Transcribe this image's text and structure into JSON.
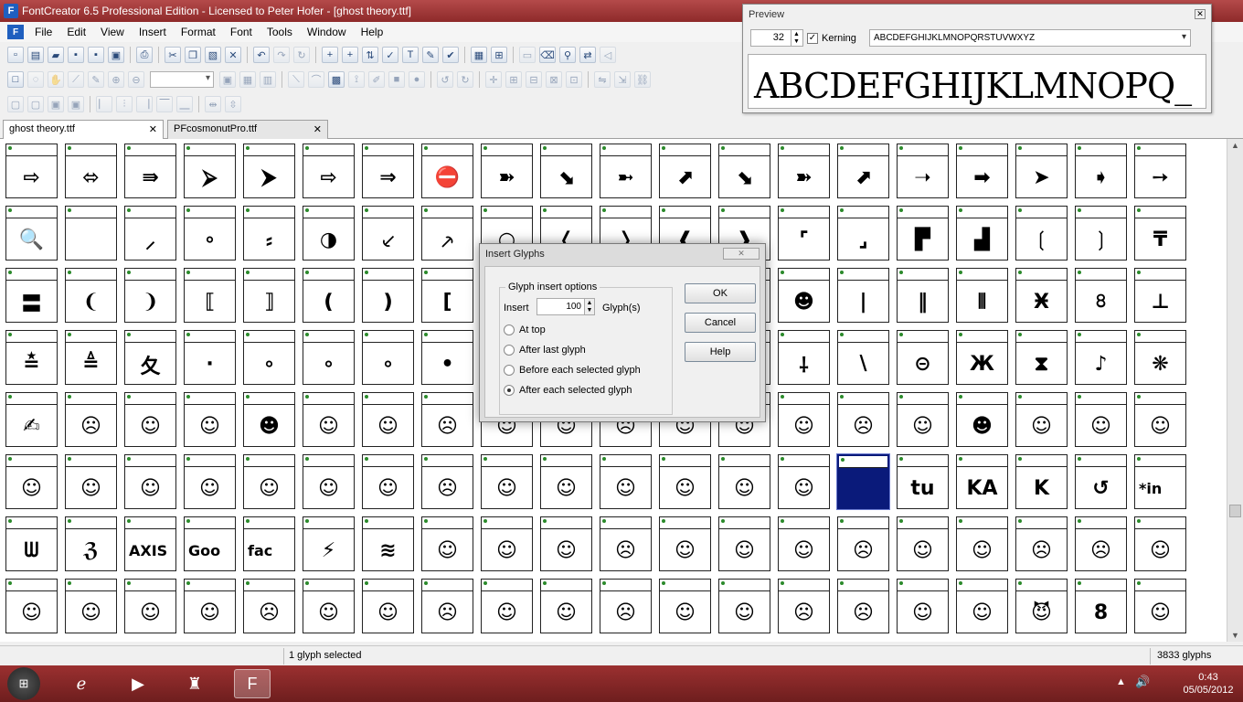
{
  "window": {
    "title": "FontCreator 6.5 Professional Edition - Licensed to Peter Hofer - [ghost theory.ttf]"
  },
  "menu": [
    "File",
    "Edit",
    "View",
    "Insert",
    "Format",
    "Font",
    "Tools",
    "Window",
    "Help"
  ],
  "tabs": [
    {
      "label": "ghost theory.ttf",
      "active": true
    },
    {
      "label": "PFcosmonutPro.ttf",
      "active": false
    }
  ],
  "preview": {
    "title": "Preview",
    "size": "32",
    "kerning_label": "Kerning",
    "kerning_checked": true,
    "sample_text": "ABCDEFGHIJKLMNOPQRSTUVWXYZ",
    "rendered_sample": "ABCDEFGHIJKLMNOPQ_"
  },
  "dialog": {
    "title": "Insert Glyphs",
    "group_title": "Glyph insert options",
    "insert_label": "Insert",
    "insert_value": "100",
    "glyphs_label": "Glyph(s)",
    "options": [
      {
        "label": "At top",
        "selected": false
      },
      {
        "label": "After last glyph",
        "selected": false
      },
      {
        "label": "Before each selected glyph",
        "selected": false
      },
      {
        "label": "After each selected glyph",
        "selected": true
      }
    ],
    "ok": "OK",
    "cancel": "Cancel",
    "help": "Help"
  },
  "glyph_rows": [
    [
      "⇨",
      "⬄",
      "⇛",
      "⮚",
      "⮞",
      "⇨",
      "⇒",
      "⛔",
      "➽",
      "⬊",
      "➼",
      "⬈",
      "⬊",
      "➽",
      "⬈",
      "➝",
      "➡",
      "➤",
      "➧",
      "➙"
    ],
    [
      "🔍",
      "",
      "⸝",
      "∘",
      "⸗",
      "◑",
      "⸔",
      "⸕",
      "○",
      "❬",
      "❭",
      "❰",
      "❱",
      "⌜",
      "⌟",
      "▛",
      "▟",
      "❲",
      "❳",
      "₸"
    ],
    [
      "〓",
      "❨",
      "❩",
      "⟦",
      "⟧",
      "❪",
      "❫",
      "[",
      "",
      "",
      "",
      "",
      "",
      "☻",
      "|",
      "‖",
      "⦀",
      "Ӿ",
      "৪",
      "⊥"
    ],
    [
      "≛",
      "≜",
      "夂",
      "·",
      "∘",
      "∘",
      "∘",
      "•",
      "",
      "",
      "",
      "",
      "",
      "⸸",
      "∖",
      "⊝",
      "Ж",
      "⧗",
      "♪",
      "❋"
    ],
    [
      "✍",
      "☹",
      "☺",
      "☺",
      "☻",
      "☺",
      "☺",
      "☹",
      "☺",
      "☺",
      "☹",
      "☺",
      "☺",
      "☺",
      "☹",
      "☺",
      "☻",
      "☺",
      "☺",
      "☺"
    ],
    [
      "☺",
      "☺",
      "☺",
      "☺",
      "☺",
      "☺",
      "☺",
      "☹",
      "☺",
      "☺",
      "☺",
      "☺",
      "☺",
      "☺",
      "",
      "tu",
      "KA",
      "K",
      "↺",
      "*in"
    ],
    [
      "ᗯ",
      "ℨ",
      "AXIS",
      "Goo",
      "fac",
      "⚡",
      "≋",
      "☺",
      "☺",
      "☺",
      "☹",
      "☺",
      "☺",
      "☺",
      "☹",
      "☺",
      "☺",
      "☹",
      "☹",
      "☺"
    ],
    [
      "☺",
      "☺",
      "☺",
      "☺",
      "☹",
      "☺",
      "☺",
      "☹",
      "☺",
      "☺",
      "☹",
      "☺",
      "☺",
      "☹",
      "☹",
      "☺",
      "☺",
      "😈",
      "8",
      "☺"
    ]
  ],
  "selected_cell": {
    "row": 5,
    "col": 14
  },
  "status": {
    "left": "1 glyph selected",
    "right": "3833 glyphs"
  },
  "taskbar": {
    "time": "0:43",
    "date": "05/05/2012"
  },
  "colors": {
    "titlebar": "#8e2a2a",
    "selection": "#0a1a7a",
    "taskbar": "#7a2020"
  }
}
